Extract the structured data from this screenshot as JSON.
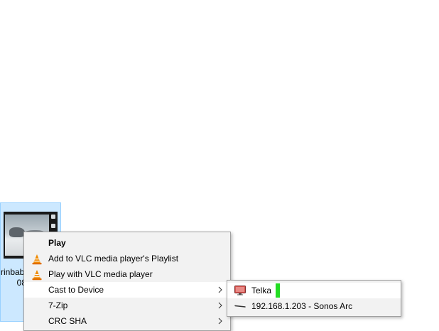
{
  "file": {
    "name_line1": "rinbab",
    "name_line2": "08"
  },
  "context_menu": {
    "items": [
      {
        "label": "Play",
        "bold": true,
        "icon": "none"
      },
      {
        "label": "Add to VLC media player's Playlist",
        "icon": "vlc-cone-icon"
      },
      {
        "label": "Play with VLC media player",
        "icon": "vlc-cone-icon"
      },
      {
        "label": "Cast to Device",
        "submenu": true,
        "highlighted": true
      },
      {
        "label": "7-Zip",
        "submenu": true
      },
      {
        "label": "CRC SHA",
        "submenu": true
      }
    ]
  },
  "cast_submenu": {
    "items": [
      {
        "label": "Telka",
        "icon": "tv-icon",
        "highlighted": true,
        "indicator_color": "#22dd22"
      },
      {
        "label": "192.168.1.203 - Sonos Arc",
        "icon": "soundbar-icon"
      }
    ]
  },
  "colors": {
    "selection_bg": "#cce8ff",
    "menu_bg": "#f2f2f2",
    "menu_highlight": "#ffffff",
    "vlc_orange": "#f08a00"
  }
}
